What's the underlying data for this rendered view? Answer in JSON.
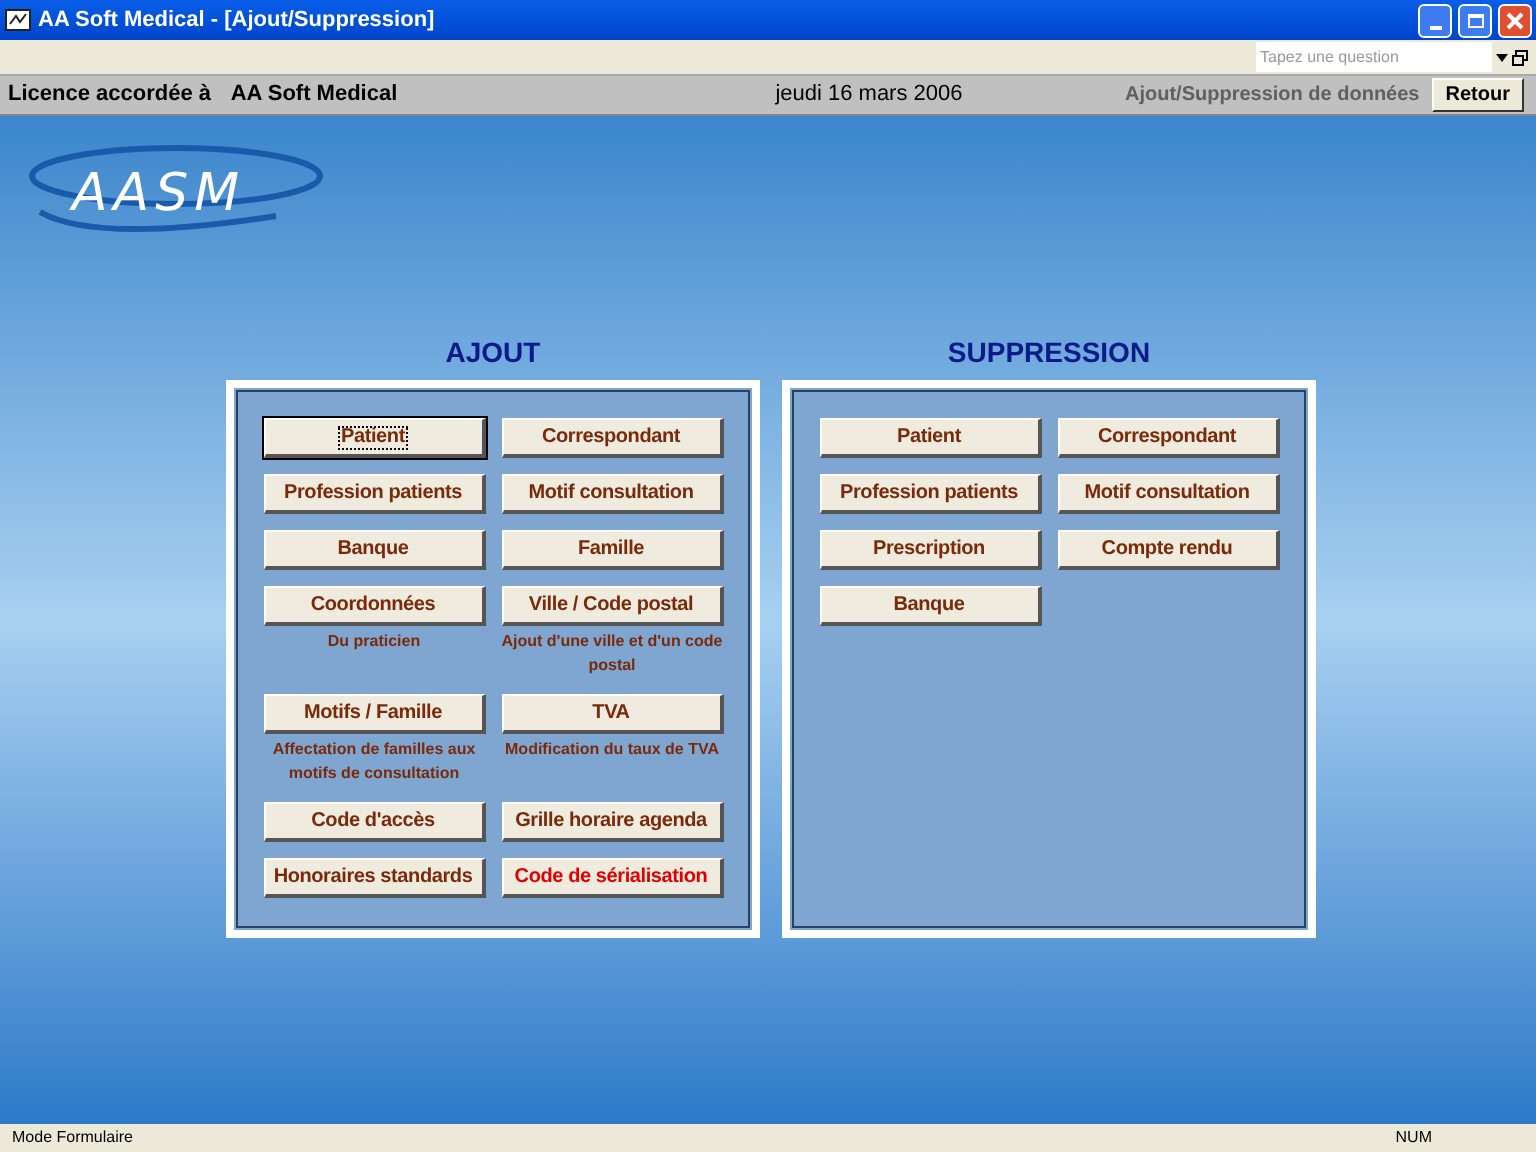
{
  "window": {
    "title": "AA Soft Medical - [Ajout/Suppression]"
  },
  "help": {
    "placeholder": "Tapez une question"
  },
  "info_bar": {
    "licence_label": "Licence accordée à",
    "licence_holder": "AA Soft Medical",
    "date": "jeudi 16 mars 2006",
    "section": "Ajout/Suppression de données",
    "back_button": "Retour"
  },
  "logo": {
    "text": "AASM"
  },
  "ajout": {
    "title": "AJOUT",
    "buttons": [
      {
        "label": "Patient",
        "focused": true,
        "kind": "standard"
      },
      {
        "label": "Correspondant",
        "focused": false,
        "kind": "standard"
      },
      {
        "label": "Profession patients",
        "focused": false,
        "kind": "standard"
      },
      {
        "label": "Motif consultation",
        "focused": false,
        "kind": "standard"
      },
      {
        "label": "Banque",
        "focused": false,
        "kind": "standard"
      },
      {
        "label": "Famille",
        "focused": false,
        "kind": "standard"
      },
      {
        "label": "Coordonnées",
        "note": "Du praticien",
        "focused": false,
        "kind": "standard"
      },
      {
        "label": "Ville / Code postal",
        "note": "Ajout d'une ville et d'un code postal",
        "focused": false,
        "kind": "standard"
      },
      {
        "label": "Motifs / Famille",
        "note": "Affectation de familles aux motifs de consultation",
        "focused": false,
        "kind": "standard"
      },
      {
        "label": "TVA",
        "note": "Modification du taux de TVA",
        "focused": false,
        "kind": "standard"
      },
      {
        "label": "Code d'accès",
        "focused": false,
        "kind": "standard"
      },
      {
        "label": "Grille horaire agenda",
        "focused": false,
        "kind": "standard"
      },
      {
        "label": "Honoraires standards",
        "focused": false,
        "kind": "standard"
      },
      {
        "label": "Code de sérialisation",
        "focused": false,
        "kind": "warning"
      }
    ]
  },
  "suppression": {
    "title": "SUPPRESSION",
    "buttons": [
      {
        "label": "Patient",
        "focused": false,
        "kind": "standard"
      },
      {
        "label": "Correspondant",
        "focused": false,
        "kind": "standard"
      },
      {
        "label": "Profession patients",
        "focused": false,
        "kind": "standard"
      },
      {
        "label": "Motif consultation",
        "focused": false,
        "kind": "standard"
      },
      {
        "label": "Prescription",
        "focused": false,
        "kind": "standard"
      },
      {
        "label": "Compte rendu",
        "focused": false,
        "kind": "standard"
      },
      {
        "label": "Banque",
        "focused": false,
        "kind": "standard"
      }
    ]
  },
  "status_bar": {
    "mode": "Mode Formulaire",
    "num": "NUM"
  }
}
